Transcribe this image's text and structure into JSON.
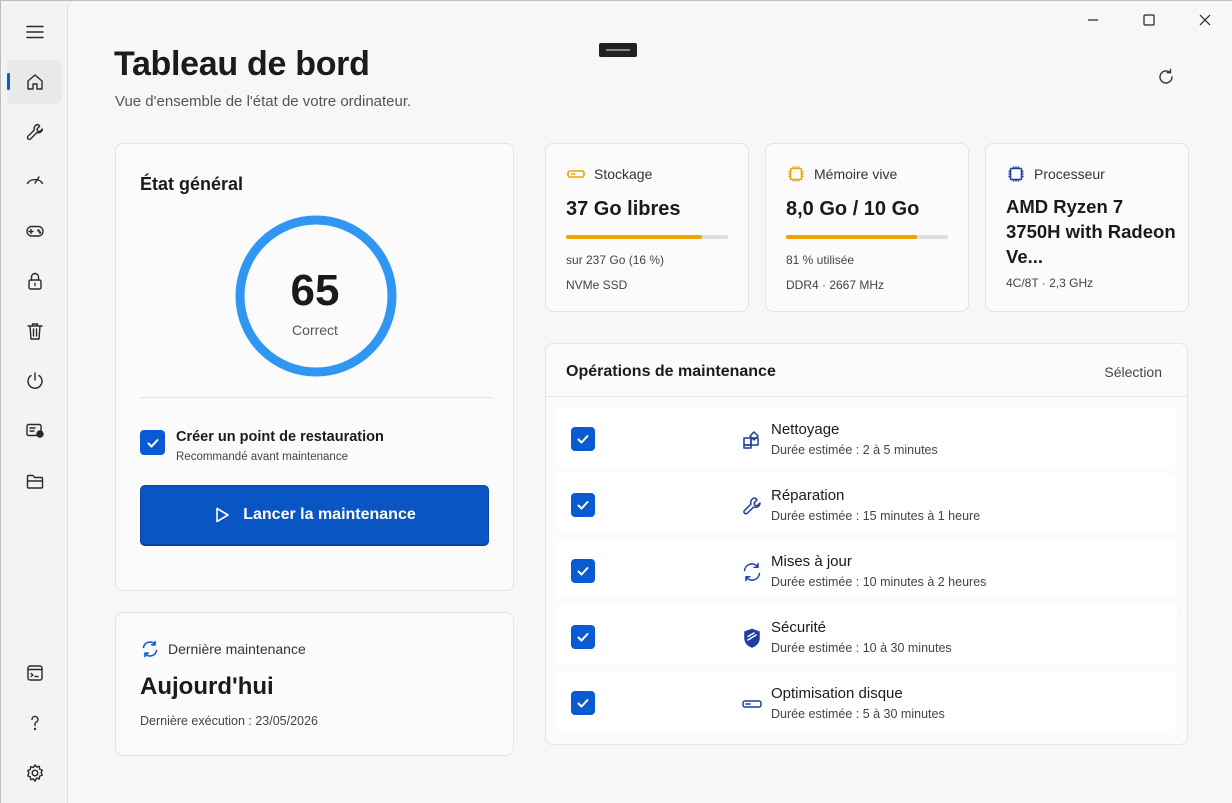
{
  "window": {
    "minimize_icon": "minimize-icon",
    "maximize_icon": "maximize-icon",
    "close_icon": "close-icon"
  },
  "nav": {
    "items": [
      {
        "icon": "menu-icon"
      },
      {
        "icon": "home-icon",
        "active": true
      },
      {
        "icon": "wrench-icon"
      },
      {
        "icon": "speed-gauge-icon"
      },
      {
        "icon": "gamepad-icon"
      },
      {
        "icon": "lock-icon"
      },
      {
        "icon": "trash-icon"
      },
      {
        "icon": "power-icon"
      },
      {
        "icon": "startup-apps-icon"
      },
      {
        "icon": "folder-icon"
      },
      {
        "icon": "terminal-icon"
      },
      {
        "icon": "help-icon"
      },
      {
        "icon": "settings-icon"
      }
    ]
  },
  "header": {
    "title": "Tableau de bord",
    "subtitle": "Vue d'ensemble de l'état de votre ordinateur."
  },
  "overall": {
    "title": "État général",
    "score": "65",
    "score_fraction": 1.0,
    "label": "Correct",
    "accent": "#2f96f3",
    "restore_checked": true,
    "restore_title": "Créer un point de restauration",
    "restore_sub": "Recommandé avant maintenance",
    "launch_label": "Lancer la maintenance"
  },
  "last": {
    "title": "Dernière maintenance",
    "value": "Aujourd'hui",
    "detail": "Dernière exécution : 23/05/2026"
  },
  "storage": {
    "title": "Stockage",
    "value": "37 Go libres",
    "fill": 0.84,
    "line1": "sur 237 Go (16 %)",
    "line2": "NVMe SSD"
  },
  "memory": {
    "title": "Mémoire vive",
    "value": "8,0 Go / 10 Go",
    "fill": 0.81,
    "line1": "81 % utilisée",
    "line2": "DDR4 · 2667 MHz"
  },
  "cpu": {
    "title": "Processeur",
    "value": "AMD Ryzen 7 3750H with Radeon Ve...",
    "line1": "4C/8T · 2,3 GHz"
  },
  "maintenance": {
    "title": "Opérations de maintenance",
    "select": "Sélection",
    "ops": [
      {
        "name": "Nettoyage",
        "duration": "Durée estimée : 2 à 5 minutes",
        "icon": "cleanup-grid-icon",
        "checked": true
      },
      {
        "name": "Réparation",
        "duration": "Durée estimée : 15 minutes à 1 heure",
        "icon": "wrench-icon",
        "checked": true
      },
      {
        "name": "Mises à jour",
        "duration": "Durée estimée : 10 minutes à 2 heures",
        "icon": "sync-icon",
        "checked": true
      },
      {
        "name": "Sécurité",
        "duration": "Durée estimée : 10 à 30 minutes",
        "icon": "shield-icon",
        "checked": true
      },
      {
        "name": "Optimisation disque",
        "duration": "Durée estimée : 5 à 30 minutes",
        "icon": "disk-icon",
        "checked": true
      }
    ]
  },
  "colors": {
    "primary": "#0a5ad4",
    "warning": "#f0a400",
    "icon_blue": "#1d3fa0"
  }
}
